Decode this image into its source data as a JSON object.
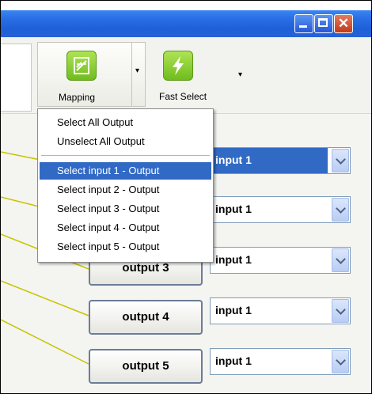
{
  "toolbar": {
    "mapping_label": "Mapping",
    "fast_select_label": "Fast Select",
    "dropdown_arrow": "▾"
  },
  "window": {
    "close_glyph": "✕"
  },
  "menu": {
    "items": [
      "Select All Output",
      "Unselect All Output",
      "Select input 1 - Output",
      "Select input 2 - Output",
      "Select input 3 - Output",
      "Select input 4 - Output",
      "Select input 5 - Output"
    ],
    "active_index": 2
  },
  "outputs": [
    "output 3",
    "output 4",
    "output 5"
  ],
  "inputs": [
    "input 1",
    "input 1",
    "input 1",
    "input 1",
    "input 1"
  ],
  "colors": {
    "accent": "#316ac5",
    "icon_green": "#7cc628",
    "title_blue": "#2a6fe6",
    "line": "#c7c300"
  }
}
